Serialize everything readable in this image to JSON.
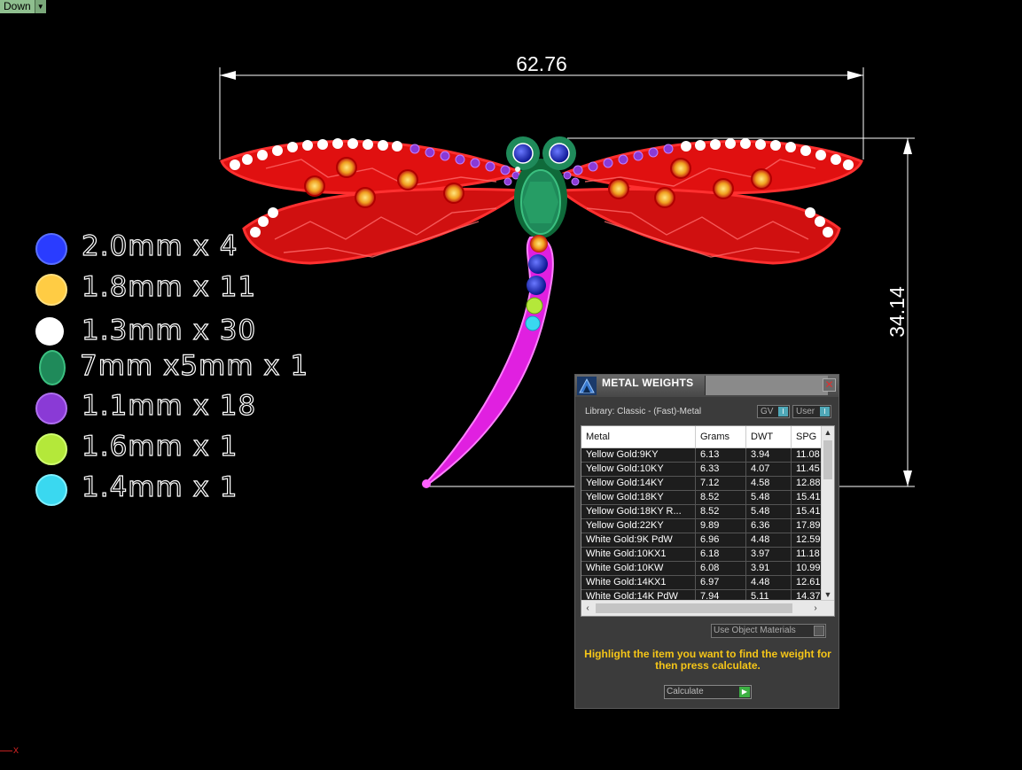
{
  "view_dropdown": {
    "label": "Down"
  },
  "dimensions": {
    "width": "62.76",
    "height": "34.14"
  },
  "legend": [
    {
      "text": "2.0mm x 4",
      "color": "#2a3cff"
    },
    {
      "text": "1.8mm x 11",
      "color": "#ffcc44"
    },
    {
      "text": "1.3mm x 30",
      "color": "#ffffff"
    },
    {
      "text": "7mm x5mm x 1",
      "color": "#1f8a5a"
    },
    {
      "text": "1.1mm x 18",
      "color": "#8a3ad6"
    },
    {
      "text": "1.6mm x 1",
      "color": "#b4e83a"
    },
    {
      "text": "1.4mm x 1",
      "color": "#3ad8f0"
    }
  ],
  "panel": {
    "title": "METAL WEIGHTS",
    "close": "✕",
    "library_label": "Library: Classic - (Fast)-Metal",
    "gv_toggle": "GV",
    "user_toggle": "User",
    "columns": [
      "Metal",
      "Grams",
      "DWT",
      "SPG"
    ],
    "rows": [
      [
        "Yellow Gold:9KY",
        "6.13",
        "3.94",
        "11.08"
      ],
      [
        "Yellow Gold:10KY",
        "6.33",
        "4.07",
        "11.45"
      ],
      [
        "Yellow Gold:14KY",
        "7.12",
        "4.58",
        "12.88"
      ],
      [
        "Yellow Gold:18KY",
        "8.52",
        "5.48",
        "15.41"
      ],
      [
        "Yellow Gold:18KY R...",
        "8.52",
        "5.48",
        "15.41"
      ],
      [
        "Yellow Gold:22KY",
        "9.89",
        "6.36",
        "17.89"
      ],
      [
        "White Gold:9K PdW",
        "6.96",
        "4.48",
        "12.59"
      ],
      [
        "White Gold:10KX1",
        "6.18",
        "3.97",
        "11.18"
      ],
      [
        "White Gold:10KW",
        "6.08",
        "3.91",
        "10.99"
      ],
      [
        "White Gold:14KX1",
        "6.97",
        "4.48",
        "12.61"
      ],
      [
        "White Gold:14K PdW",
        "7.94",
        "5.11",
        "14.37"
      ]
    ],
    "use_object_materials": "Use Object Materials",
    "hint": "Highlight the item you want to find the weight for then press calculate.",
    "calculate": "Calculate"
  },
  "axis": {
    "x_label": "x"
  },
  "colors": {
    "wing": "#ff1a1a",
    "body_tail": "#e020e0",
    "dimension_lines": "#ffffff",
    "hint_text": "#f5c518"
  }
}
